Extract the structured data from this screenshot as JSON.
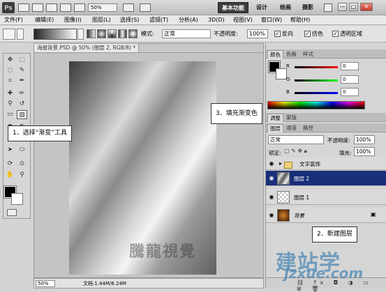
{
  "app": {
    "logo": "Ps",
    "zoom": "50%"
  },
  "workspaces": [
    "基本功能",
    "设计",
    "绘画",
    "摄影"
  ],
  "window_buttons": [
    "—",
    "□",
    "✕"
  ],
  "menu": [
    "文件(F)",
    "编辑(E)",
    "图像(I)",
    "图层(L)",
    "选择(S)",
    "滤镜(T)",
    "分析(A)",
    "3D(D)",
    "视图(V)",
    "窗口(W)",
    "帮助(H)"
  ],
  "options": {
    "mode_label": "模式:",
    "mode_value": "正常",
    "opacity_label": "不透明度:",
    "opacity_value": "100%",
    "reverse": "反向",
    "dither": "仿色",
    "transparency": "透明区域"
  },
  "document": {
    "tab_title": "海报背景.PSD @ 50% (图层 2, RGB/8) *",
    "watermark": "騰龍視覺",
    "status_zoom": "50%",
    "doc_info": "文档:1.44M/6.24M"
  },
  "color_panel": {
    "tabs": [
      "颜色",
      "色板",
      "样式"
    ],
    "labels": [
      "R",
      "G",
      "B"
    ],
    "values": [
      "0",
      "0",
      "0"
    ]
  },
  "adjust_tabs": [
    "调整",
    "蒙版"
  ],
  "layers_panel": {
    "tabs": [
      "图层",
      "通道",
      "路径"
    ],
    "blend_mode": "正常",
    "opacity_label": "不透明度:",
    "opacity_value": "100%",
    "lock_label": "锁定:",
    "fill_label": "填充:",
    "fill_value": "100%",
    "layers": [
      {
        "name": "文字装饰",
        "type": "group"
      },
      {
        "name": "图层 2",
        "selected": true
      },
      {
        "name": "图层 1"
      },
      {
        "name": "背景",
        "locked": true
      }
    ]
  },
  "callouts": {
    "step1": "1、选择“渐变”工具",
    "step2": "2、新建图层",
    "step3": "3、填充渐变色"
  },
  "watermark_site": {
    "big": "建站学",
    "url": "jzxue.com"
  },
  "colors": {
    "selected_layer": "#1a2f7a",
    "watermark_blue": "#1e6eaa"
  }
}
